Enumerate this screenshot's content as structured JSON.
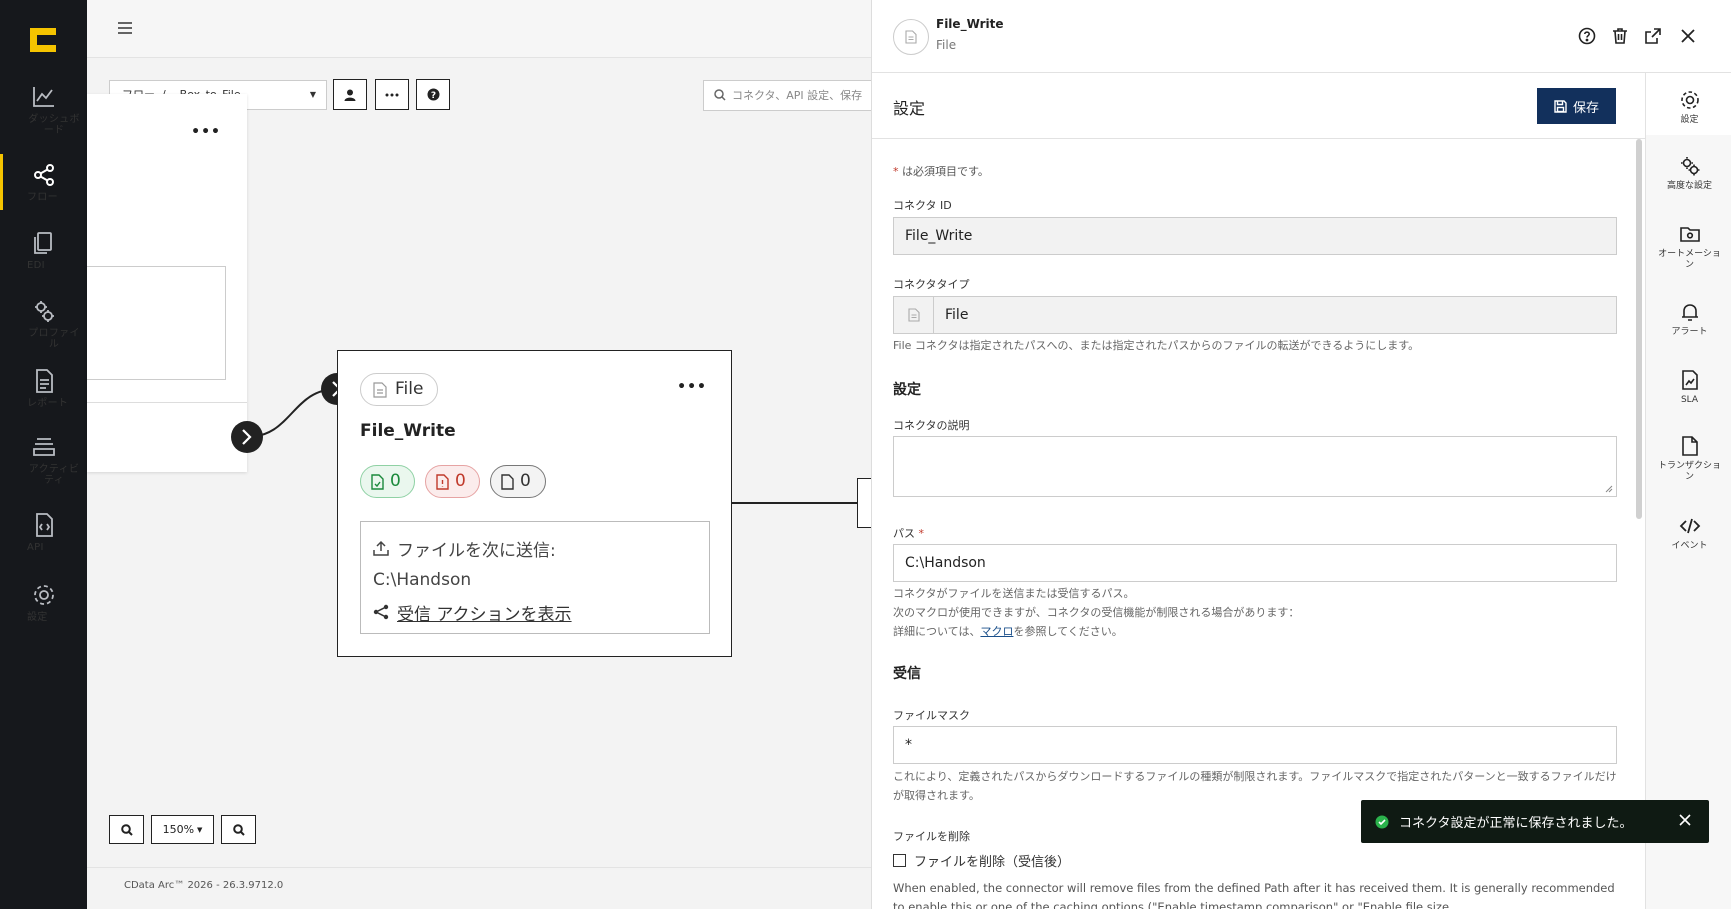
{
  "nav": {
    "items": [
      {
        "label": "ダッシュボード"
      },
      {
        "label": "フロー"
      },
      {
        "label": "EDI"
      },
      {
        "label": "プロファイル"
      },
      {
        "label": "レポート"
      },
      {
        "label": "アクティビティ"
      },
      {
        "label": "API"
      },
      {
        "label": "設定"
      }
    ]
  },
  "canvas": {
    "breadcrumb": "フロー  /    Box_to_File",
    "search_placeholder": "コネクタ、API 設定、保存",
    "zoom_level": "150%",
    "version": "CData Arc™ 2026 - 26.3.9712.0",
    "node": {
      "type_label": "File",
      "title": "File_Write",
      "green_count": "0",
      "red_count": "0",
      "gray_count": "0",
      "send_label": "ファイルを次に送信:",
      "send_path": "C:\\Handson",
      "receive_link": "受信 アクションを表示"
    }
  },
  "panel": {
    "connector_name": "File_Write",
    "connector_type": "File",
    "section_title": "設定",
    "save_label": "保存",
    "required_note": "は必須項目です。",
    "fields": {
      "connector_id_label": "コネクタ ID",
      "connector_id_value": "File_Write",
      "connector_type_label": "コネクタタイプ",
      "connector_type_value": "File",
      "connector_type_help": "File コネクタは指定されたパスへの、または指定されたパスからのファイルの転送ができるようにします。",
      "settings_heading": "設定",
      "description_label": "コネクタの説明",
      "path_label": "パス",
      "path_value": "C:\\Handson",
      "path_help_1": "コネクタがファイルを送信または受信するパス。",
      "path_help_2": "次のマクロが使用できますが、コネクタの受信機能が制限される場合があります：",
      "path_help_3a": "詳細については、",
      "path_help_3_link": "マクロ",
      "path_help_3b": "を参照してください。",
      "receive_heading": "受信",
      "filemask_label": "ファイルマスク",
      "filemask_value": "*",
      "filemask_help": "これにより、定義されたパスからダウンロードするファイルの種類が制限されます。ファイルマスクで指定されたパターンと一致するファイルだけが取得されます。",
      "delete_label": "ファイルを削除",
      "delete_checkbox_label": "ファイルを削除（受信後）",
      "delete_help": "When enabled, the connector will remove files from the defined Path after it has received them. It is generally recommended to enable this or one of the caching options (\"Enable timestamp comparison\" or \"Enable file size"
    }
  },
  "rail": {
    "items": [
      {
        "label": "設定"
      },
      {
        "label": "高度な設定"
      },
      {
        "label": "オートメーション"
      },
      {
        "label": "アラート"
      },
      {
        "label": "SLA"
      },
      {
        "label": "トランザクション"
      },
      {
        "label": "イベント"
      }
    ]
  },
  "toast": {
    "message": "コネクタ設定が正常に保存されました。"
  },
  "colors": {
    "nav_bg": "#16181c",
    "accent": "#f5c400",
    "save_bg": "#12305c",
    "toast_bg": "#0f1a13",
    "success": "#2bb24c"
  }
}
